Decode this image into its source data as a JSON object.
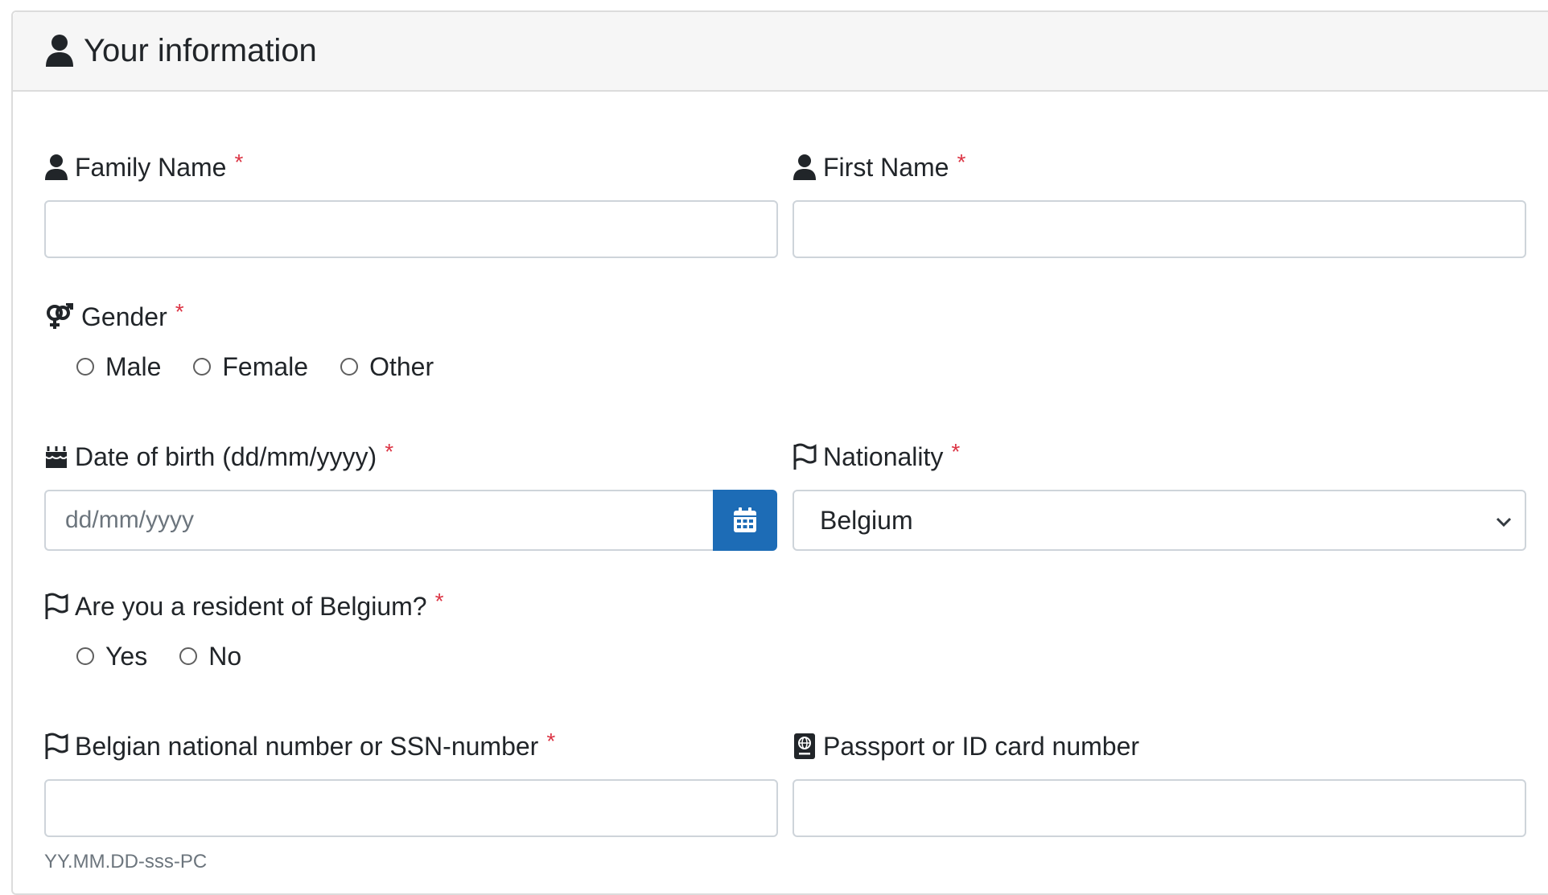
{
  "header": {
    "title": "Your information",
    "icon": "user-icon"
  },
  "required_mark": "*",
  "fields": {
    "family_name": {
      "label": "Family Name",
      "icon": "user-icon",
      "value": "",
      "placeholder": ""
    },
    "first_name": {
      "label": "First Name",
      "icon": "user-icon",
      "value": "",
      "placeholder": ""
    },
    "gender": {
      "label": "Gender",
      "icon": "gender-icon",
      "options": [
        "Male",
        "Female",
        "Other"
      ],
      "selected": null
    },
    "date_of_birth": {
      "label": "Date of birth (dd/mm/yyyy)",
      "icon": "birthday-cake-icon",
      "value": "",
      "placeholder": "dd/mm/yyyy",
      "button_icon": "calendar-icon"
    },
    "nationality": {
      "label": "Nationality",
      "icon": "flag-icon",
      "selected": "Belgium"
    },
    "resident": {
      "label": "Are you a resident of Belgium?",
      "icon": "flag-icon",
      "options": [
        "Yes",
        "No"
      ],
      "selected": null
    },
    "national_number": {
      "label": "Belgian national number or SSN-number",
      "icon": "flag-icon",
      "value": "",
      "placeholder": "",
      "help": "YY.MM.DD-sss-PC"
    },
    "passport": {
      "label": "Passport or ID card number",
      "icon": "passport-icon",
      "value": "",
      "placeholder": ""
    }
  },
  "colors": {
    "accent": "#1d6cb6",
    "required": "#dc3545",
    "border": "#ced4da",
    "header_bg": "#f6f6f6"
  }
}
